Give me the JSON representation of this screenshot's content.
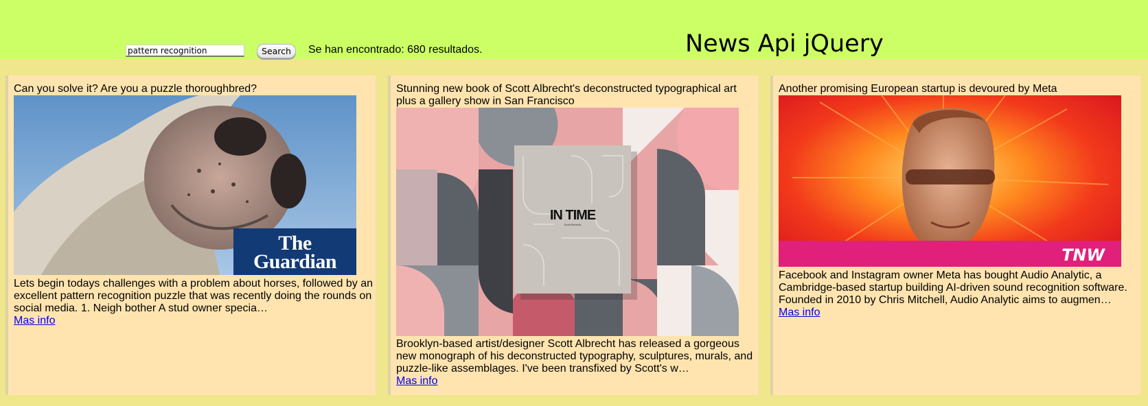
{
  "header": {
    "title": "News Api jQuery",
    "search_value": "pattern recognition",
    "search_button_label": "Search",
    "result_text": "Se han encontrado: 680 resultados."
  },
  "articles": [
    {
      "title": "Can you solve it? Are you a puzzle thoroughbred?",
      "description": "Lets begin todays challenges with a problem about horses, followed by an excellent pattern recognition puzzle that was recently doing the rounds on social media. 1. Neigh bother A stud owner specia…",
      "link_label": "Mas info",
      "image_logo_lines": [
        "The",
        "Guardian"
      ]
    },
    {
      "title": "Stunning new book of Scott Albrecht's deconstructed typographical art plus a gallery show in San Francisco",
      "description": "Brooklyn-based artist/designer Scott Albrecht has released a gorgeous new monograph of his deconstructed typography, sculptures, murals, and puzzle-like assemblages. I've been transfixed by Scott's w…",
      "link_label": "Mas info",
      "image_book_title": "IN TIME",
      "image_book_author": "Scott Albrecht"
    },
    {
      "title": "Another promising European startup is devoured by Meta",
      "description": "Facebook and Instagram owner Meta has bought Audio Analytic, a Cambridge-based startup building AI-driven sound recognition software. Founded in 2010 by Chris Mitchell, Audio Analytic aims to augmen…",
      "link_label": "Mas info",
      "image_logo": "TNW"
    }
  ],
  "colors": {
    "header_bg": "#ccff66",
    "page_bg": "#f0e68c",
    "card_bg": "#ffe4b0",
    "link": "#0000ee",
    "guardian_blue": "#123a74",
    "tnw_magenta": "#e0207a"
  }
}
